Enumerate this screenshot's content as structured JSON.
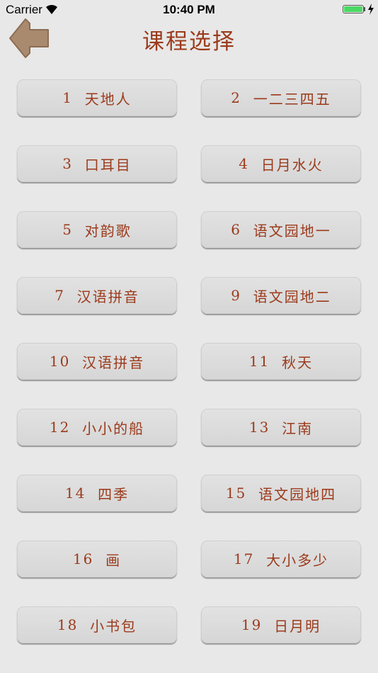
{
  "status_bar": {
    "carrier": "Carrier",
    "time": "10:40 PM",
    "battery_level": 1.0,
    "battery_color": "#4cd964"
  },
  "header": {
    "back_icon": "arrow-left-icon",
    "back_icon_color": "#a98a6f",
    "title": "课程选择"
  },
  "colors": {
    "text_accent": "#9b3a1b",
    "background": "#e8e8e8",
    "button_bg": "#dcdcdc"
  },
  "lessons": [
    {
      "number": "1",
      "title": "天地人"
    },
    {
      "number": "2",
      "title": "一二三四五"
    },
    {
      "number": "3",
      "title": "口耳目"
    },
    {
      "number": "4",
      "title": "日月水火"
    },
    {
      "number": "5",
      "title": "对韵歌"
    },
    {
      "number": "6",
      "title": "语文园地一"
    },
    {
      "number": "7",
      "title": "汉语拼音"
    },
    {
      "number": "9",
      "title": "语文园地二"
    },
    {
      "number": "10",
      "title": "汉语拼音"
    },
    {
      "number": "11",
      "title": "秋天"
    },
    {
      "number": "12",
      "title": "小小的船"
    },
    {
      "number": "13",
      "title": "江南"
    },
    {
      "number": "14",
      "title": "四季"
    },
    {
      "number": "15",
      "title": "语文园地四"
    },
    {
      "number": "16",
      "title": "画"
    },
    {
      "number": "17",
      "title": "大小多少"
    },
    {
      "number": "18",
      "title": "小书包"
    },
    {
      "number": "19",
      "title": "日月明"
    }
  ]
}
